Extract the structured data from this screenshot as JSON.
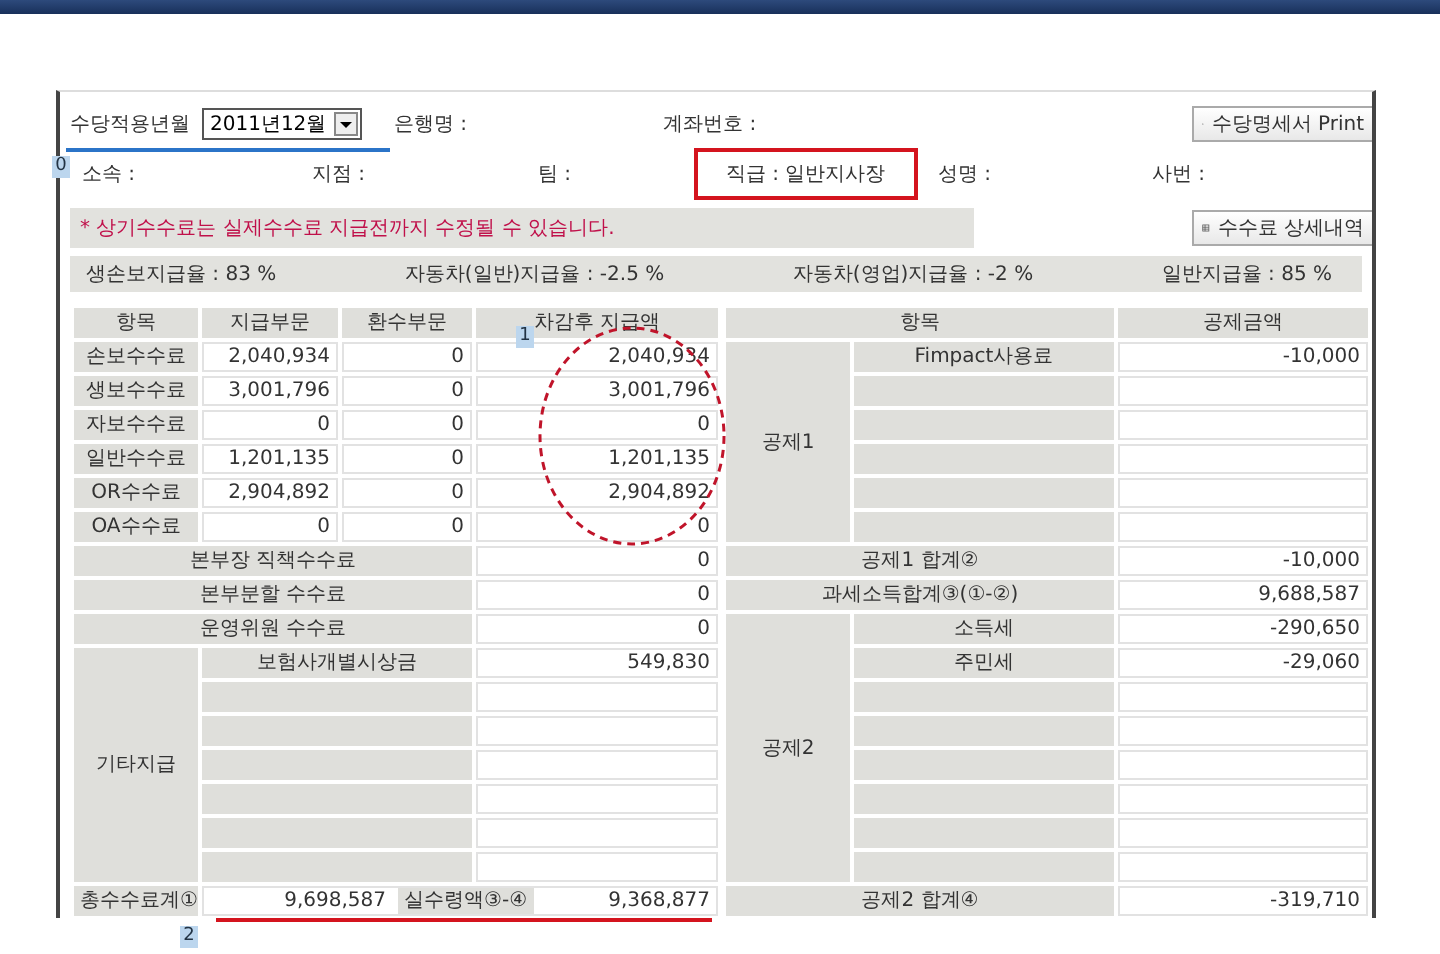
{
  "header": {
    "month_label": "수당적용년월",
    "month_value": "2011년12월",
    "bank_label": "은행명 :",
    "account_label": "계좌번호 :",
    "print_button": "수당명세서 Print"
  },
  "info": [
    {
      "kind": "plain",
      "text": "소속 :"
    },
    {
      "kind": "plain",
      "text": "지점 :"
    },
    {
      "kind": "plain",
      "text": "팀 :"
    },
    {
      "kind": "highlight",
      "text": "직급 : 일반지사장"
    },
    {
      "kind": "plain",
      "text": "성명 :"
    },
    {
      "kind": "plain",
      "text": "사번 :"
    }
  ],
  "notice": {
    "text": "* 상기수수료는 실제수수료 지급전까지 수정될 수 있습니다.",
    "button": "수수료 상세내역"
  },
  "rates": [
    "생손보지급율 : 83 %",
    "자동차(일반)지급율 :  -2.5 %",
    "자동차(영업)지급율 :  -2 %",
    "일반지급율 : 85 %"
  ],
  "left_table": {
    "columns": [
      "항목",
      "지급부문",
      "환수부문",
      "차감후 지급액"
    ],
    "rows": [
      {
        "item": "손보수수료",
        "pay": "2,040,934",
        "refund": "0",
        "net": "2,040,934"
      },
      {
        "item": "생보수수료",
        "pay": "3,001,796",
        "refund": "0",
        "net": "3,001,796"
      },
      {
        "item": "자보수수료",
        "pay": "0",
        "refund": "0",
        "net": "0"
      },
      {
        "item": "일반수수료",
        "pay": "1,201,135",
        "refund": "0",
        "net": "1,201,135"
      },
      {
        "item": "OR수수료",
        "pay": "2,904,892",
        "refund": "0",
        "net": "2,904,892"
      },
      {
        "item": "OA수수료",
        "pay": "0",
        "refund": "0",
        "net": "0"
      }
    ],
    "extra_rows": [
      {
        "label": "본부장 직책수수료",
        "value": "0"
      },
      {
        "label": "본부분할 수수료",
        "value": "0"
      },
      {
        "label": "운영위원 수수료",
        "value": "0"
      }
    ],
    "other": {
      "label": "기타지급",
      "items": [
        {
          "label": "보험사개별시상금",
          "value": "549,830"
        }
      ]
    },
    "total": {
      "label": "총수수료계①",
      "value": "9,698,587",
      "net_label": "실수령액③-④",
      "net_value": "9,368,877"
    }
  },
  "right_table": {
    "columns": [
      "항목",
      "공제금액"
    ],
    "deduction1": {
      "label": "공제1",
      "items": [
        {
          "label": "Fimpact사용료",
          "value": "-10,000"
        }
      ]
    },
    "sum1": {
      "label": "공제1 합계②",
      "value": "-10,000"
    },
    "taxable": {
      "label": "과세소득합계③(①-②)",
      "value": "9,688,587"
    },
    "deduction2": {
      "label": "공제2",
      "items": [
        {
          "label": "소득세",
          "value": "-290,650"
        },
        {
          "label": "주민세",
          "value": "-29,060"
        }
      ]
    },
    "sum2": {
      "label": "공제2 합계④",
      "value": "-319,710"
    }
  },
  "markers": [
    "0",
    "1",
    "2"
  ]
}
